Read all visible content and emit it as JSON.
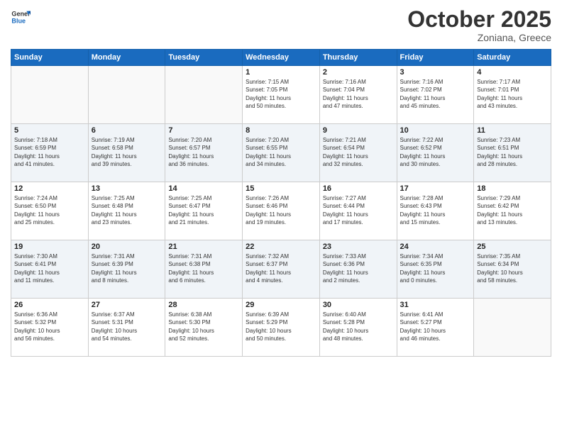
{
  "logo": {
    "line1": "General",
    "line2": "Blue"
  },
  "header": {
    "month": "October 2025",
    "location": "Zoniana, Greece"
  },
  "weekdays": [
    "Sunday",
    "Monday",
    "Tuesday",
    "Wednesday",
    "Thursday",
    "Friday",
    "Saturday"
  ],
  "weeks": [
    [
      {
        "day": "",
        "info": ""
      },
      {
        "day": "",
        "info": ""
      },
      {
        "day": "",
        "info": ""
      },
      {
        "day": "1",
        "info": "Sunrise: 7:15 AM\nSunset: 7:05 PM\nDaylight: 11 hours\nand 50 minutes."
      },
      {
        "day": "2",
        "info": "Sunrise: 7:16 AM\nSunset: 7:04 PM\nDaylight: 11 hours\nand 47 minutes."
      },
      {
        "day": "3",
        "info": "Sunrise: 7:16 AM\nSunset: 7:02 PM\nDaylight: 11 hours\nand 45 minutes."
      },
      {
        "day": "4",
        "info": "Sunrise: 7:17 AM\nSunset: 7:01 PM\nDaylight: 11 hours\nand 43 minutes."
      }
    ],
    [
      {
        "day": "5",
        "info": "Sunrise: 7:18 AM\nSunset: 6:59 PM\nDaylight: 11 hours\nand 41 minutes."
      },
      {
        "day": "6",
        "info": "Sunrise: 7:19 AM\nSunset: 6:58 PM\nDaylight: 11 hours\nand 39 minutes."
      },
      {
        "day": "7",
        "info": "Sunrise: 7:20 AM\nSunset: 6:57 PM\nDaylight: 11 hours\nand 36 minutes."
      },
      {
        "day": "8",
        "info": "Sunrise: 7:20 AM\nSunset: 6:55 PM\nDaylight: 11 hours\nand 34 minutes."
      },
      {
        "day": "9",
        "info": "Sunrise: 7:21 AM\nSunset: 6:54 PM\nDaylight: 11 hours\nand 32 minutes."
      },
      {
        "day": "10",
        "info": "Sunrise: 7:22 AM\nSunset: 6:52 PM\nDaylight: 11 hours\nand 30 minutes."
      },
      {
        "day": "11",
        "info": "Sunrise: 7:23 AM\nSunset: 6:51 PM\nDaylight: 11 hours\nand 28 minutes."
      }
    ],
    [
      {
        "day": "12",
        "info": "Sunrise: 7:24 AM\nSunset: 6:50 PM\nDaylight: 11 hours\nand 25 minutes."
      },
      {
        "day": "13",
        "info": "Sunrise: 7:25 AM\nSunset: 6:48 PM\nDaylight: 11 hours\nand 23 minutes."
      },
      {
        "day": "14",
        "info": "Sunrise: 7:25 AM\nSunset: 6:47 PM\nDaylight: 11 hours\nand 21 minutes."
      },
      {
        "day": "15",
        "info": "Sunrise: 7:26 AM\nSunset: 6:46 PM\nDaylight: 11 hours\nand 19 minutes."
      },
      {
        "day": "16",
        "info": "Sunrise: 7:27 AM\nSunset: 6:44 PM\nDaylight: 11 hours\nand 17 minutes."
      },
      {
        "day": "17",
        "info": "Sunrise: 7:28 AM\nSunset: 6:43 PM\nDaylight: 11 hours\nand 15 minutes."
      },
      {
        "day": "18",
        "info": "Sunrise: 7:29 AM\nSunset: 6:42 PM\nDaylight: 11 hours\nand 13 minutes."
      }
    ],
    [
      {
        "day": "19",
        "info": "Sunrise: 7:30 AM\nSunset: 6:41 PM\nDaylight: 11 hours\nand 11 minutes."
      },
      {
        "day": "20",
        "info": "Sunrise: 7:31 AM\nSunset: 6:39 PM\nDaylight: 11 hours\nand 8 minutes."
      },
      {
        "day": "21",
        "info": "Sunrise: 7:31 AM\nSunset: 6:38 PM\nDaylight: 11 hours\nand 6 minutes."
      },
      {
        "day": "22",
        "info": "Sunrise: 7:32 AM\nSunset: 6:37 PM\nDaylight: 11 hours\nand 4 minutes."
      },
      {
        "day": "23",
        "info": "Sunrise: 7:33 AM\nSunset: 6:36 PM\nDaylight: 11 hours\nand 2 minutes."
      },
      {
        "day": "24",
        "info": "Sunrise: 7:34 AM\nSunset: 6:35 PM\nDaylight: 11 hours\nand 0 minutes."
      },
      {
        "day": "25",
        "info": "Sunrise: 7:35 AM\nSunset: 6:34 PM\nDaylight: 10 hours\nand 58 minutes."
      }
    ],
    [
      {
        "day": "26",
        "info": "Sunrise: 6:36 AM\nSunset: 5:32 PM\nDaylight: 10 hours\nand 56 minutes."
      },
      {
        "day": "27",
        "info": "Sunrise: 6:37 AM\nSunset: 5:31 PM\nDaylight: 10 hours\nand 54 minutes."
      },
      {
        "day": "28",
        "info": "Sunrise: 6:38 AM\nSunset: 5:30 PM\nDaylight: 10 hours\nand 52 minutes."
      },
      {
        "day": "29",
        "info": "Sunrise: 6:39 AM\nSunset: 5:29 PM\nDaylight: 10 hours\nand 50 minutes."
      },
      {
        "day": "30",
        "info": "Sunrise: 6:40 AM\nSunset: 5:28 PM\nDaylight: 10 hours\nand 48 minutes."
      },
      {
        "day": "31",
        "info": "Sunrise: 6:41 AM\nSunset: 5:27 PM\nDaylight: 10 hours\nand 46 minutes."
      },
      {
        "day": "",
        "info": ""
      }
    ]
  ]
}
